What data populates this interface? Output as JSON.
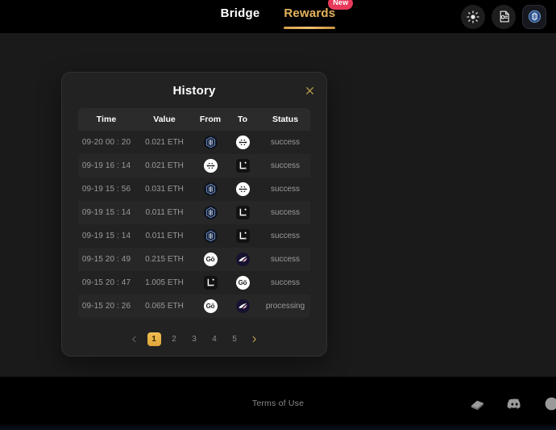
{
  "header": {
    "nav": [
      {
        "label": "Bridge",
        "active": false,
        "badge": null,
        "name": "nav-bridge"
      },
      {
        "label": "Rewards",
        "active": true,
        "badge": "New",
        "name": "nav-rewards"
      }
    ],
    "actions": [
      {
        "icon": "sun-icon",
        "name": "theme-toggle-button"
      },
      {
        "icon": "document-icon",
        "name": "docs-button"
      },
      {
        "icon": "wallet-icon",
        "name": "wallet-button"
      }
    ]
  },
  "panel": {
    "title": "History",
    "close_label": "×",
    "columns": [
      "Time",
      "Value",
      "From",
      "To",
      "Status"
    ],
    "rows": [
      {
        "time": "09-20 00 : 20",
        "value": "0.021 ETH",
        "from": "scroll",
        "to": "arrows",
        "status": "success"
      },
      {
        "time": "09-19 16 : 14",
        "value": "0.021 ETH",
        "from": "arrows",
        "to": "linea",
        "status": "success"
      },
      {
        "time": "09-19 15 : 56",
        "value": "0.031 ETH",
        "from": "scroll",
        "to": "arrows",
        "status": "success"
      },
      {
        "time": "09-19 15 : 14",
        "value": "0.011 ETH",
        "from": "scroll",
        "to": "linea",
        "status": "success"
      },
      {
        "time": "09-19 15 : 14",
        "value": "0.011 ETH",
        "from": "scroll",
        "to": "linea",
        "status": "success"
      },
      {
        "time": "09-15 20 : 49",
        "value": "0.215 ETH",
        "from": "goerli",
        "to": "taiko",
        "status": "success"
      },
      {
        "time": "09-15 20 : 47",
        "value": "1.005 ETH",
        "from": "linea",
        "to": "goerli",
        "status": "success"
      },
      {
        "time": "09-15 20 : 26",
        "value": "0.065 ETH",
        "from": "goerli",
        "to": "taiko",
        "status": "processing"
      }
    ],
    "pagination": {
      "prev": "‹",
      "next": "›",
      "pages": [
        "1",
        "2",
        "3",
        "4",
        "5"
      ],
      "current": "1"
    }
  },
  "footer": {
    "terms": "Terms of Use",
    "socials": [
      {
        "icon": "book-icon",
        "name": "docs-link"
      },
      {
        "icon": "discord-icon",
        "name": "discord-link"
      },
      {
        "icon": "twitter-icon",
        "name": "twitter-link"
      }
    ]
  },
  "colors": {
    "accent": "#e5b45c",
    "badge": "#e8395a",
    "header_bg": "#000000",
    "page_bg": "#1a1a1a",
    "panel_bg": "#222222"
  }
}
